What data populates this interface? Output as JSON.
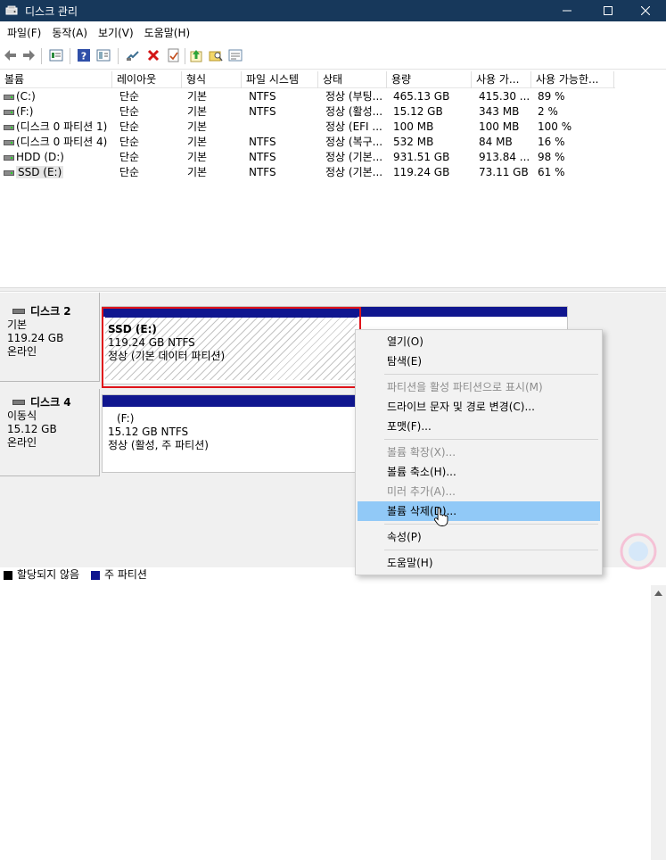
{
  "window": {
    "title": "디스크 관리",
    "controls": [
      "minimize-icon",
      "maximize-icon",
      "close-icon"
    ]
  },
  "menubar": [
    "파일(F)",
    "동작(A)",
    "보기(V)",
    "도움말(H)"
  ],
  "toolbar_icons": [
    "back-arrow-icon",
    "forward-arrow-icon",
    "list-view-icon",
    "help-icon",
    "panel-view-icon",
    "connect-icon",
    "delete-icon",
    "check-icon",
    "upload-icon",
    "search-folder-icon",
    "properties-icon"
  ],
  "volume_table": {
    "columns": [
      "볼륨",
      "레이아웃",
      "형식",
      "파일 시스템",
      "상태",
      "용량",
      "사용 가...",
      "사용 가능한..."
    ],
    "rows": [
      [
        "(C:)",
        "단순",
        "기본",
        "NTFS",
        "정상 (부팅...",
        "465.13 GB",
        "415.30 ...",
        "89 %"
      ],
      [
        "(F:)",
        "단순",
        "기본",
        "NTFS",
        "정상 (활성...",
        "15.12 GB",
        "343 MB",
        "2 %"
      ],
      [
        "(디스크 0 파티션 1)",
        "단순",
        "기본",
        "",
        "정상 (EFI ...",
        "100 MB",
        "100 MB",
        "100 %"
      ],
      [
        "(디스크 0 파티션 4)",
        "단순",
        "기본",
        "NTFS",
        "정상 (복구...",
        "532 MB",
        "84 MB",
        "16 %"
      ],
      [
        "HDD (D:)",
        "단순",
        "기본",
        "NTFS",
        "정상 (기본...",
        "931.51 GB",
        "913.84 ...",
        "98 %"
      ],
      [
        "SSD (E:)",
        "단순",
        "기본",
        "NTFS",
        "정상 (기본...",
        "119.24 GB",
        "73.11 GB",
        "61 %"
      ]
    ]
  },
  "disks": [
    {
      "name": "디스크 2",
      "type": "기본",
      "size": "119.24 GB",
      "status": "온라인",
      "partition": {
        "label": "SSD  (E:)",
        "size_fs": "119.24 GB NTFS",
        "status": "정상 (기본 데이터 파티션)"
      }
    },
    {
      "name": "디스크 4",
      "type": "이동식",
      "size": "15.12 GB",
      "status": "온라인",
      "partition": {
        "label": "(F:)",
        "size_fs": "15.12 GB NTFS",
        "status": "정상 (활성, 주 파티션)"
      }
    }
  ],
  "context_menu": {
    "items": [
      {
        "label": "열기(O)",
        "enabled": true
      },
      {
        "label": "탐색(E)",
        "enabled": true
      },
      {
        "label": "파티션을 활성 파티션으로 표시(M)",
        "enabled": false
      },
      {
        "label": "드라이브 문자 및 경로 변경(C)...",
        "enabled": true
      },
      {
        "label": "포맷(F)...",
        "enabled": true
      },
      {
        "label": "볼륨 확장(X)...",
        "enabled": false
      },
      {
        "label": "볼륨 축소(H)...",
        "enabled": true
      },
      {
        "label": "미러 추가(A)...",
        "enabled": false
      },
      {
        "label": "볼륨 삭제(D)...",
        "enabled": true,
        "highlighted": true
      },
      {
        "label": "속성(P)",
        "enabled": true
      },
      {
        "label": "도움말(H)",
        "enabled": true
      }
    ]
  },
  "legend": [
    {
      "label": "할당되지 않음",
      "color": "#000000"
    },
    {
      "label": "주 파티션",
      "color": "#10168f"
    }
  ],
  "colors": {
    "titlebar": "#17385b",
    "partition_stripe": "#10168f",
    "selection_frame": "#e0141b",
    "menu_highlight": "#91c9f7"
  }
}
